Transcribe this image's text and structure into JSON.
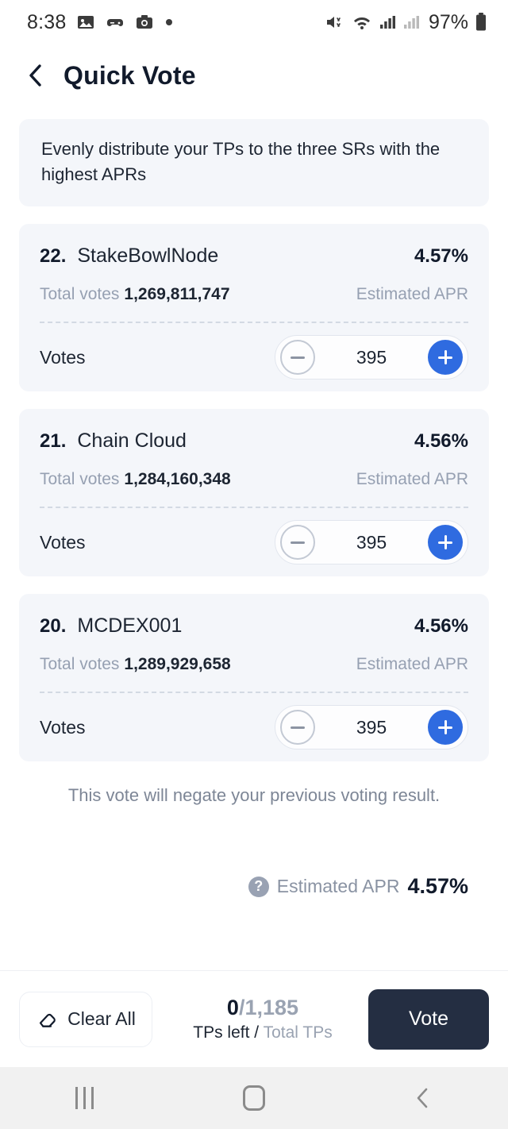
{
  "status_bar": {
    "time": "8:38",
    "battery_text": "97%",
    "left_icons": [
      "image-icon",
      "game-icon",
      "camera-icon",
      "dot-icon"
    ],
    "right_icons": [
      "volume-mute-icon",
      "wifi-icon",
      "signal-icon",
      "signal-icon-secondary",
      "battery-icon"
    ]
  },
  "header": {
    "back_icon": "chevron-left-icon",
    "title": "Quick Vote"
  },
  "notice": {
    "text": "Evenly distribute your TPs to the three SRs with the highest APRs"
  },
  "cards": [
    {
      "rank": "22.",
      "name": "StakeBowlNode",
      "apr": "4.57%",
      "total_votes_label": "Total votes",
      "total_votes_value": "1,269,811,747",
      "apr_label": "Estimated APR",
      "votes_label": "Votes",
      "votes_value": "395",
      "minus_icon": "minus-circle-icon",
      "plus_icon": "plus-circle-icon"
    },
    {
      "rank": "21.",
      "name": "Chain Cloud",
      "apr": "4.56%",
      "total_votes_label": "Total votes",
      "total_votes_value": "1,284,160,348",
      "apr_label": "Estimated APR",
      "votes_label": "Votes",
      "votes_value": "395",
      "minus_icon": "minus-circle-icon",
      "plus_icon": "plus-circle-icon"
    },
    {
      "rank": "20.",
      "name": "MCDEX001",
      "apr": "4.56%",
      "total_votes_label": "Total votes",
      "total_votes_value": "1,289,929,658",
      "apr_label": "Estimated APR",
      "votes_label": "Votes",
      "votes_value": "395",
      "minus_icon": "minus-circle-icon",
      "plus_icon": "plus-circle-icon"
    }
  ],
  "negate_note": "This vote will negate your previous voting result.",
  "summary": {
    "help_icon": "question-mark-icon",
    "help_glyph": "?",
    "label": "Estimated APR",
    "value": "4.57%"
  },
  "action_bar": {
    "clear_icon": "eraser-icon",
    "clear_label": "Clear All",
    "tps_left": "0",
    "tps_separator": "/",
    "tps_total": "1,185",
    "caption_left": "TPs left /",
    "caption_right": "Total TPs",
    "vote_label": "Vote"
  },
  "nav_bar": {
    "recents_icon": "recents-icon",
    "home_icon": "home-icon",
    "back_icon": "back-chevron-icon"
  },
  "colors": {
    "accent_blue": "#2f6be0",
    "dark_navy": "#242e42",
    "card_bg": "#f4f6fa",
    "muted_text": "#96a0b2"
  }
}
